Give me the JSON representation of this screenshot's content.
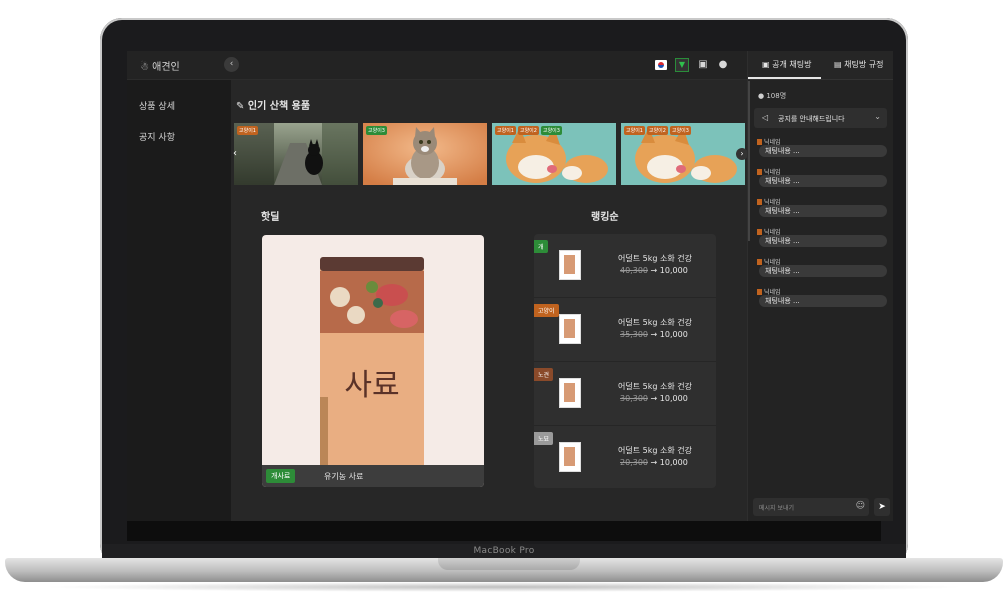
{
  "device": {
    "label": "MacBook Pro"
  },
  "app": {
    "logo": "☃ 애견인",
    "collapse_icon": "‹"
  },
  "topbar": {
    "icons": [
      "korean-flag-icon",
      "dropdown-icon",
      "message-icon",
      "user-icon"
    ]
  },
  "sidebar": {
    "items": [
      {
        "label": "상품 상세"
      },
      {
        "label": "공지 사항"
      }
    ]
  },
  "popular": {
    "title": "인기 산책 용품",
    "title_icon": "✎",
    "slides": [
      {
        "tags": [
          "고양이1"
        ],
        "tag_color": "#c0631f",
        "scene": "black-cat-on-path"
      },
      {
        "tags": [
          "고양이3"
        ],
        "tag_color": "#2d8c38",
        "scene": "tabby-cat-sitting"
      },
      {
        "tags": [
          "고양이1",
          "고양이2",
          "고양이3"
        ],
        "tag_color": "#2d8c38",
        "scene": "orange-cat-licking"
      },
      {
        "tags": [
          "고양이1",
          "고양이2",
          "고양이3"
        ],
        "tag_color": "#c0631f",
        "scene": "orange-cat-licking"
      }
    ],
    "prev_arrow": "‹",
    "next_arrow": "›"
  },
  "hotdeal": {
    "title": "핫딜",
    "product_label": "사료",
    "badge": "개사료",
    "name": "유기농 사료"
  },
  "ranking": {
    "title": "랭킹순",
    "rows": [
      {
        "badge": "개",
        "badge_color": "#2d8c38",
        "name": "어덜트 5kg 소화 건강",
        "old_price": "40,300",
        "arrow": "→",
        "price": "10,000"
      },
      {
        "badge": "고양이",
        "badge_color": "#c0631f",
        "name": "어덜트 5kg 소화 건강",
        "old_price": "35,300",
        "arrow": "→",
        "price": "10,000"
      },
      {
        "badge": "노견",
        "badge_color": "#8a4a2a",
        "name": "어덜트 5kg 소화 건강",
        "old_price": "30,300",
        "arrow": "→",
        "price": "10,000"
      },
      {
        "badge": "노묘",
        "badge_color": "#9a9a9a",
        "name": "어덜트 5kg 소화 건강",
        "old_price": "20,300",
        "arrow": "→",
        "price": "10,000"
      }
    ]
  },
  "chat": {
    "tabs": [
      {
        "label": "공개 채팅방",
        "icon": "chat-bubble-icon"
      },
      {
        "label": "채팅방 규정",
        "icon": "document-icon"
      }
    ],
    "user_count": "108명",
    "notice": "공지를 안내해드립니다",
    "messages": [
      {
        "nick": "닉네임",
        "text": "채팅내용 ..."
      },
      {
        "nick": "닉네임",
        "text": "채팅내용 ..."
      },
      {
        "nick": "닉네임",
        "text": "채팅내용 ..."
      },
      {
        "nick": "닉네임",
        "text": "채팅내용 ..."
      },
      {
        "nick": "닉네임",
        "text": "채팅내용 ..."
      },
      {
        "nick": "닉네임",
        "text": "채팅내용 ..."
      }
    ],
    "input_placeholder": "메시지 보내기",
    "send_icon": "➤",
    "emoji_icon": "☺"
  }
}
